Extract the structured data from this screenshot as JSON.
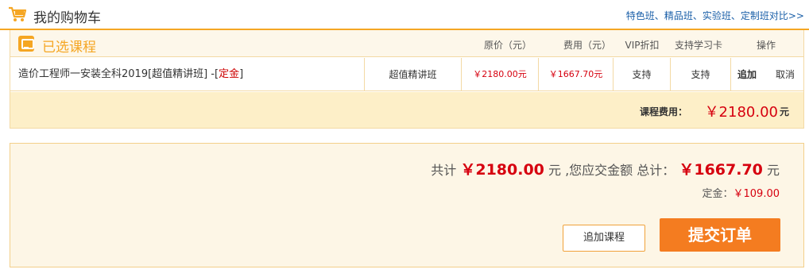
{
  "header": {
    "title": "我的购物车",
    "links": [
      "特色班",
      "精品班",
      "实验班",
      "定制班对比>>"
    ],
    "link_separator": "、",
    "icon": "cart-icon"
  },
  "course_table": {
    "section_title": "已选课程",
    "columns": {
      "original_price": "原价（元）",
      "fee": "费用（元）",
      "vip": "VIP折扣",
      "study_card": "支持学习卡",
      "operation": "操作"
    },
    "row": {
      "name_prefix": "造价工程师一安装全科2019[超值精讲班] -[",
      "name_deposit": "定金",
      "name_suffix": "]",
      "class_type": "超值精讲班",
      "original_price": "￥2180.00元",
      "fee": "￥1667.70元",
      "vip": "支持",
      "study_card": "支持",
      "add": "追加",
      "cancel": "取消"
    },
    "course_fee_label": "课程费用：",
    "course_fee_value": "￥2180.00",
    "course_fee_unit": "元"
  },
  "summary": {
    "total_prefix": "共计",
    "total_value": "￥2180.00",
    "total_mid": "元 ,您应交金额 总计：",
    "payable_value": "￥1667.70",
    "payable_unit": "元",
    "deposit_label": "定金：",
    "deposit_value": "￥109.00",
    "add_course_button": "追加课程",
    "submit_button": "提交订单"
  },
  "colors": {
    "accent": "#f5a623",
    "price_red": "#d6000f",
    "submit_bg": "#f47c20",
    "link_blue": "#1a5fa8"
  }
}
